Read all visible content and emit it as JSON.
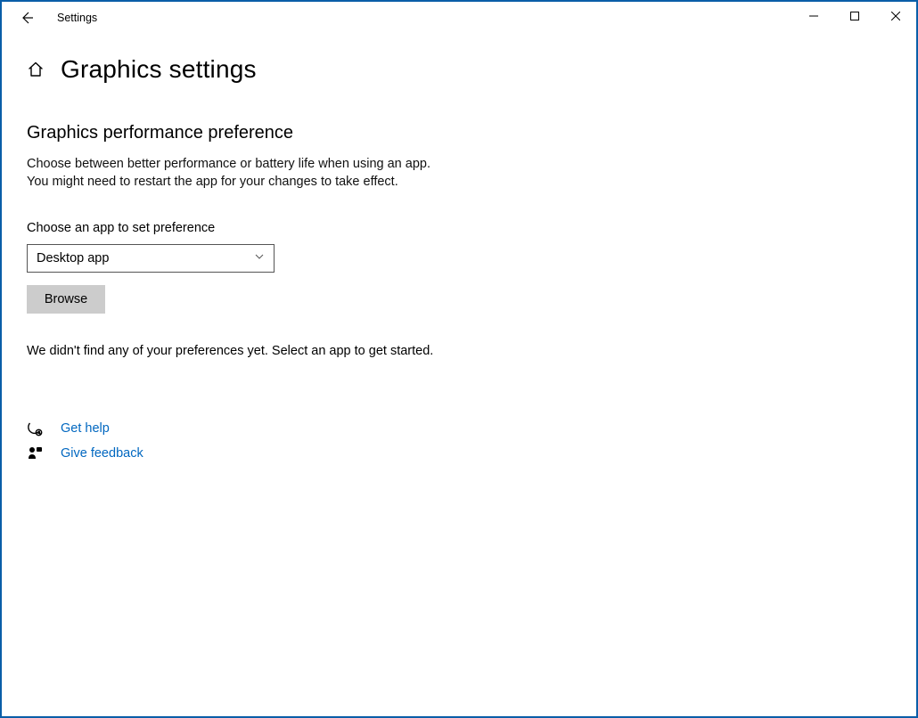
{
  "window": {
    "title": "Settings"
  },
  "page": {
    "title": "Graphics settings"
  },
  "section": {
    "heading": "Graphics performance preference",
    "description_line1": "Choose between better performance or battery life when using an app.",
    "description_line2": "You might need to restart the app for your changes to take effect.",
    "choose_label": "Choose an app to set preference",
    "dropdown_value": "Desktop app",
    "browse_label": "Browse",
    "status": "We didn't find any of your preferences yet. Select an app to get started."
  },
  "links": {
    "help": "Get help",
    "feedback": "Give feedback"
  }
}
